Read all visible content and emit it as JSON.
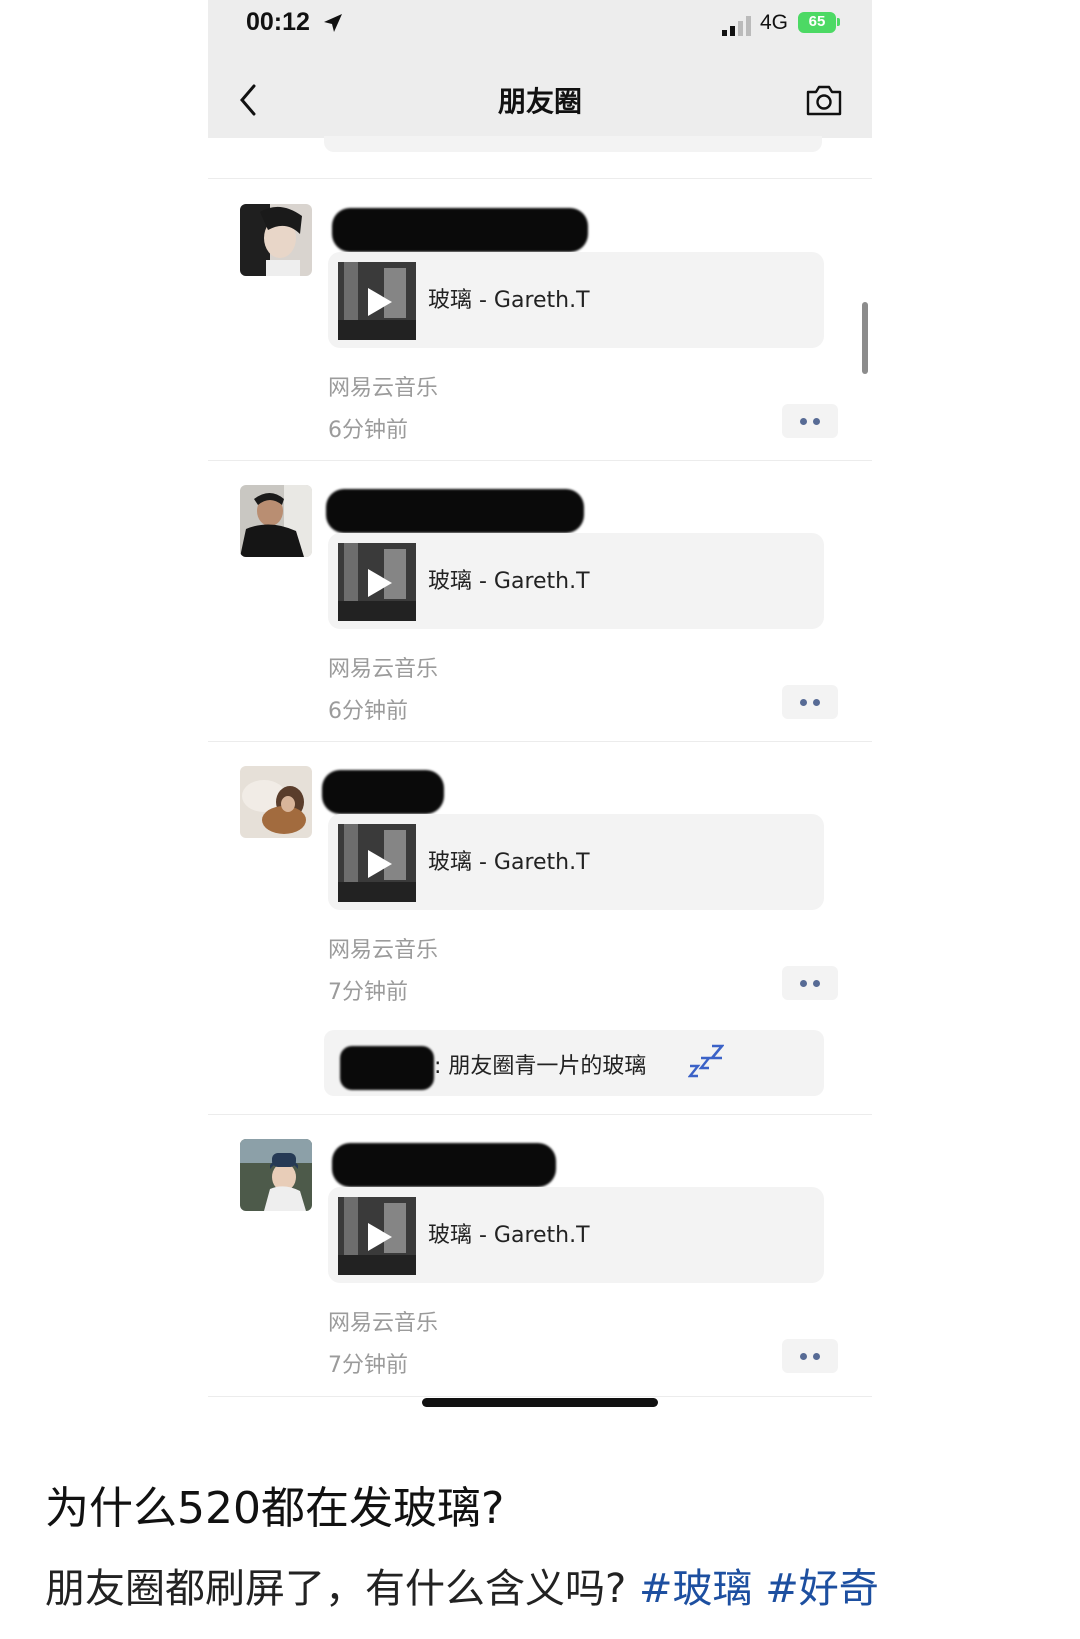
{
  "status_bar": {
    "time": "00:12",
    "network": "4G",
    "battery": "65"
  },
  "nav": {
    "title": "朋友圈"
  },
  "posts": [
    {
      "song": "玻璃 - Gareth.T",
      "source": "网易云音乐",
      "time": "6分钟前"
    },
    {
      "song": "玻璃 - Gareth.T",
      "source": "网易云音乐",
      "time": "6分钟前"
    },
    {
      "song": "玻璃 - Gareth.T",
      "source": "网易云音乐",
      "time": "7分钟前",
      "comment": ": 朋友圈青一片的玻璃"
    },
    {
      "song": "玻璃 - Gareth.T",
      "source": "网易云音乐",
      "time": "7分钟前"
    }
  ],
  "caption": {
    "title": "为什么520都在发玻璃?",
    "body": "朋友圈都刷屏了，有什么含义吗?",
    "tags": [
      "#玻璃",
      "#好奇"
    ]
  },
  "colors": {
    "link": "#576b95",
    "hashtag": "#1d4fa0",
    "battery": "#4cd964"
  }
}
